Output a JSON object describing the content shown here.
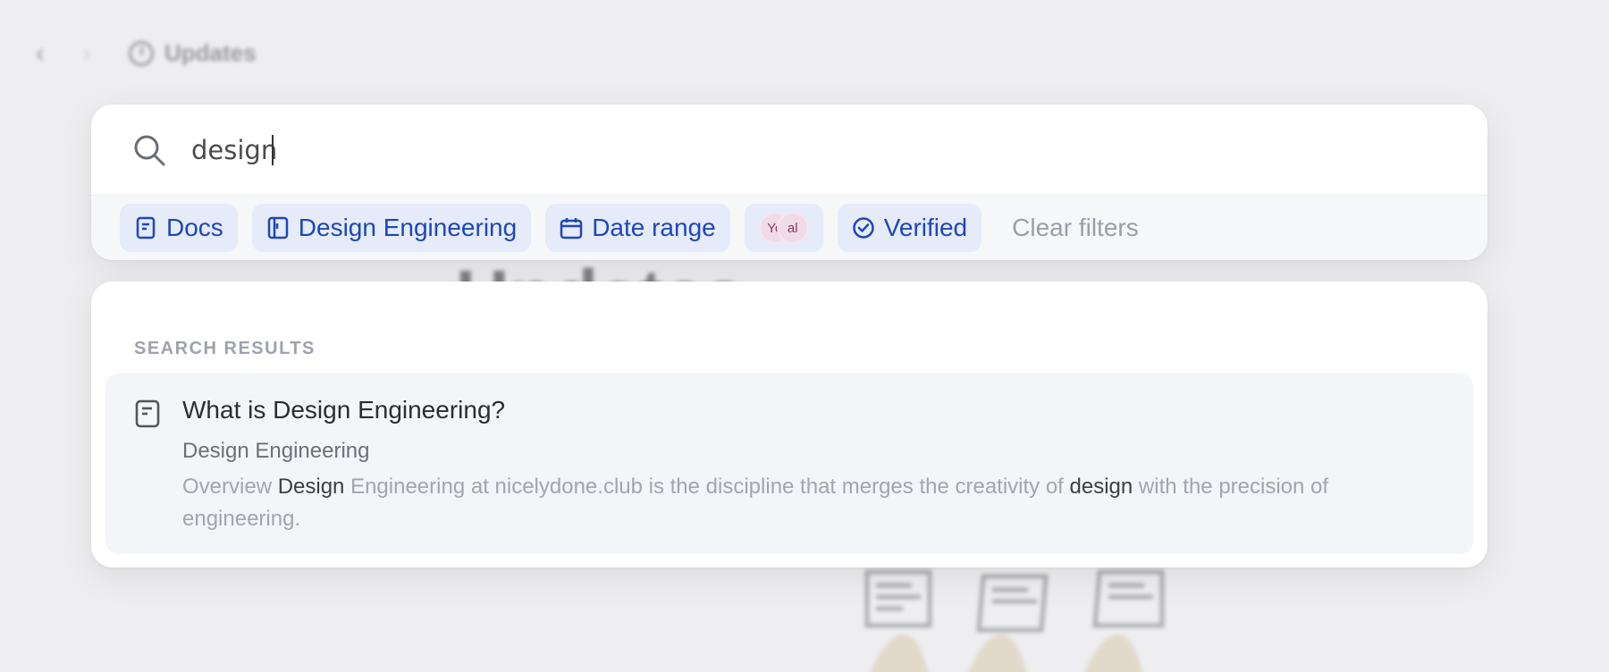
{
  "background": {
    "nav_back_glyph": "‹",
    "nav_forward_glyph": "›",
    "breadcrumb_label": "Updates",
    "page_title": "Updates"
  },
  "search": {
    "query": "design",
    "icon": "search-icon"
  },
  "filters": {
    "chips": [
      {
        "label": "Docs",
        "icon": "doc-icon"
      },
      {
        "label": "Design Engineering",
        "icon": "book-icon"
      },
      {
        "label": "Date range",
        "icon": "calendar-icon"
      },
      {
        "label": "Verified",
        "icon": "check-circle-icon"
      }
    ],
    "avatars": [
      "Yo",
      "al"
    ],
    "clear_label": "Clear filters"
  },
  "results": {
    "heading": "SEARCH RESULTS",
    "items": [
      {
        "title": "What is Design Engineering?",
        "collection": "Design Engineering",
        "snippet_parts": [
          {
            "text": "Overview ",
            "highlight": false
          },
          {
            "text": "Design",
            "highlight": true
          },
          {
            "text": " Engineering at nicelydone.club is the discipline that merges the creativity of ",
            "highlight": false
          },
          {
            "text": "design",
            "highlight": true
          },
          {
            "text": " with the precision of engineering.",
            "highlight": false
          }
        ]
      }
    ]
  },
  "colors": {
    "chip_bg": "#e5ebf8",
    "chip_text": "#1d47b9",
    "page_bg": "#eeeef0"
  }
}
